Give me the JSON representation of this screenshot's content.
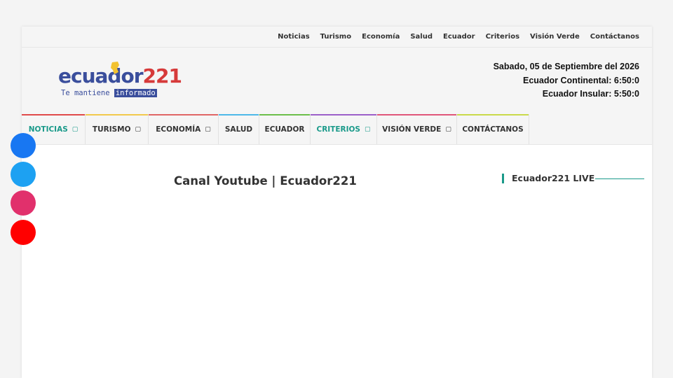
{
  "top_nav": [
    "Noticias",
    "Turismo",
    "Economía",
    "Salud",
    "Ecuador",
    "Criterios",
    "Visión Verde",
    "Contáctanos"
  ],
  "logo": {
    "word_part1": "ecuador",
    "word_part2": "221",
    "tagline_part1": "Te mantiene ",
    "tagline_part2": "informado"
  },
  "datetime": {
    "date": "Sabado, 05 de Septiembre del 2026",
    "continental": "Ecuador Continental: 6:50:0",
    "insular": "Ecuador Insular: 5:50:0"
  },
  "main_nav": [
    {
      "label": "NOTICIAS",
      "caret": "▢",
      "color": "#e04a4a",
      "active": true
    },
    {
      "label": "TURISMO",
      "caret": "▢",
      "color": "#f2c94c",
      "active": false
    },
    {
      "label": "ECONOMÍA",
      "caret": "▢",
      "color": "#e06666",
      "active": false
    },
    {
      "label": "SALUD",
      "caret": "",
      "color": "#4db8e8",
      "active": false
    },
    {
      "label": "ECUADOR",
      "caret": "",
      "color": "#6cbf4a",
      "active": false
    },
    {
      "label": "CRITERIOS",
      "caret": "▢",
      "color": "#9c5fc9",
      "active": true
    },
    {
      "label": "VISIÓN VERDE",
      "caret": "▢",
      "color": "#e0567a",
      "active": false
    },
    {
      "label": "CONTÁCTANOS",
      "caret": "",
      "color": "#c9d94a",
      "active": false
    }
  ],
  "content": {
    "title": "Canal Youtube | Ecuador221"
  },
  "widget": {
    "title": "Ecuador221 LIVE"
  },
  "social": [
    {
      "icon": "facebook-icon",
      "color": "#1877f2"
    },
    {
      "icon": "twitter-icon",
      "color": "#1da1f2"
    },
    {
      "icon": "instagram-icon",
      "color": "#e1306c"
    },
    {
      "icon": "youtube-icon",
      "color": "#ff0000"
    }
  ],
  "colors": {
    "accent": "#1a9a8a",
    "logo_blue": "#3a4e9c",
    "logo_red": "#d63a3a"
  }
}
